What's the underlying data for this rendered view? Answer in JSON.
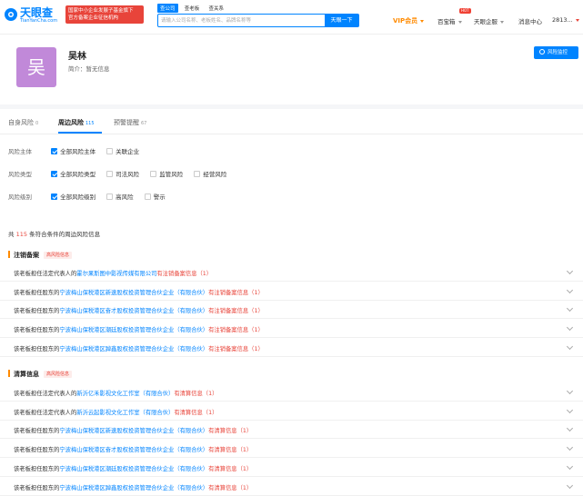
{
  "header": {
    "logo_cn": "天眼查",
    "logo_en": "TianYanCha.com",
    "gov_badge_line1": "国家中小企业发展子基金旗下",
    "gov_badge_line2": "官方备案企业征信机构",
    "search_tabs": [
      "查公司",
      "查老板",
      "查关系"
    ],
    "search_placeholder": "请输入公司名称、老板姓名、品牌名称等",
    "search_button": "天眼一下",
    "nav_vip": "VIP会员",
    "nav_hot_badge": "HOT",
    "nav_baibao": "百宝箱",
    "nav_enterprise": "天眼企服",
    "nav_messages": "消息中心",
    "nav_user": "2813..."
  },
  "profile": {
    "avatar_char": "吴",
    "name": "吴林",
    "intro": "简介：暂无信息",
    "monitor_button": "风险监控"
  },
  "tabs": [
    {
      "label": "自身风险",
      "count": "0",
      "active": false
    },
    {
      "label": "周边风险",
      "count": "115",
      "active": true
    },
    {
      "label": "预警提醒",
      "count": "67",
      "active": false
    }
  ],
  "filters": [
    {
      "label": "风险主体",
      "options": [
        {
          "text": "全部风险主体",
          "checked": true
        },
        {
          "text": "关联企业",
          "checked": false
        }
      ]
    },
    {
      "label": "风险类型",
      "options": [
        {
          "text": "全部风险类型",
          "checked": true
        },
        {
          "text": "司法风险",
          "checked": false
        },
        {
          "text": "监管风险",
          "checked": false
        },
        {
          "text": "经营风险",
          "checked": false
        }
      ]
    },
    {
      "label": "风险级别",
      "options": [
        {
          "text": "全部风险级别",
          "checked": true
        },
        {
          "text": "高风险",
          "checked": false
        },
        {
          "text": "警示",
          "checked": false
        }
      ]
    }
  ],
  "summary": {
    "prefix": "共",
    "count": "115",
    "suffix": "条符合条件的周边风险信息"
  },
  "sections": [
    {
      "title": "注销备案",
      "tag": "高风险信息",
      "rows": [
        {
          "prefix": "该老板担任法定代表人的",
          "company": "霍尔果斯图中影视传媒有限公司",
          "info": "有注销备案信息（1）"
        },
        {
          "prefix": "该老板担任股东的",
          "company": "宁波梅山保税港区新速股权投资管理合伙企业（有限合伙）",
          "info": "有注销备案信息（1）"
        },
        {
          "prefix": "该老板担任股东的",
          "company": "宁波梅山保税港区奋才股权投资管理合伙企业（有限合伙）",
          "info": "有注销备案信息（1）"
        },
        {
          "prefix": "该老板担任股东的",
          "company": "宁波梅山保税港区潮廷股权投资管理合伙企业（有限合伙）",
          "info": "有注销备案信息（1）"
        },
        {
          "prefix": "该老板担任股东的",
          "company": "宁波梅山保税港区踔鑫股权投资管理合伙企业（有限合伙）",
          "info": "有注销备案信息（1）"
        }
      ]
    },
    {
      "title": "清算信息",
      "tag": "高风险信息",
      "rows": [
        {
          "prefix": "该老板担任法定代表人的",
          "company": "新沂亿禾影视文化工作室（有限合伙）",
          "info": "有清算信息（1）"
        },
        {
          "prefix": "该老板担任法定代表人的",
          "company": "新沂云起影视文化工作室（有限合伙）",
          "info": "有清算信息（1）"
        },
        {
          "prefix": "该老板担任股东的",
          "company": "宁波梅山保税港区新速股权投资管理合伙企业（有限合伙）",
          "info": "有清算信息（1）"
        },
        {
          "prefix": "该老板担任股东的",
          "company": "宁波梅山保税港区奋才股权投资管理合伙企业（有限合伙）",
          "info": "有清算信息（1）"
        },
        {
          "prefix": "该老板担任股东的",
          "company": "宁波梅山保税港区潮廷股权投资管理合伙企业（有限合伙）",
          "info": "有清算信息（1）"
        },
        {
          "prefix": "该老板担任股东的",
          "company": "宁波梅山保税港区踔鑫股权投资管理合伙企业（有限合伙）",
          "info": "有清算信息（1）"
        }
      ]
    }
  ]
}
